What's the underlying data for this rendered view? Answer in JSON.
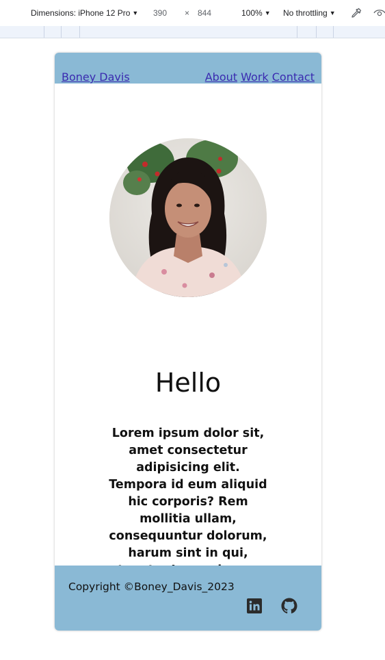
{
  "devtools": {
    "dimensions_label": "Dimensions: iPhone 12 Pro",
    "width": "390",
    "times": "×",
    "height": "844",
    "zoom": "100%",
    "throttling": "No throttling",
    "icons": [
      "caret-down-icon",
      "eyedropper-icon",
      "eye-icon"
    ]
  },
  "site": {
    "brand": "Boney Davis",
    "nav": [
      "About",
      "Work",
      "Contact"
    ],
    "heading": "Hello",
    "intro": "Lorem ipsum dolor sit, amet consectetur adipisicing elit. Tempora id eum aliquid hic corporis? Rem mollitia ullam, consequuntur dolorum, harum sint in qui, tenetur.Lorem ipsum",
    "footer_copyright": "Copyright ©Boney_Davis_2023",
    "social_icons": [
      "linkedin-icon",
      "github-icon"
    ]
  },
  "colors": {
    "header_footer_bg": "#8ab9d5",
    "link": "#3a2bb0",
    "text": "#111111"
  }
}
